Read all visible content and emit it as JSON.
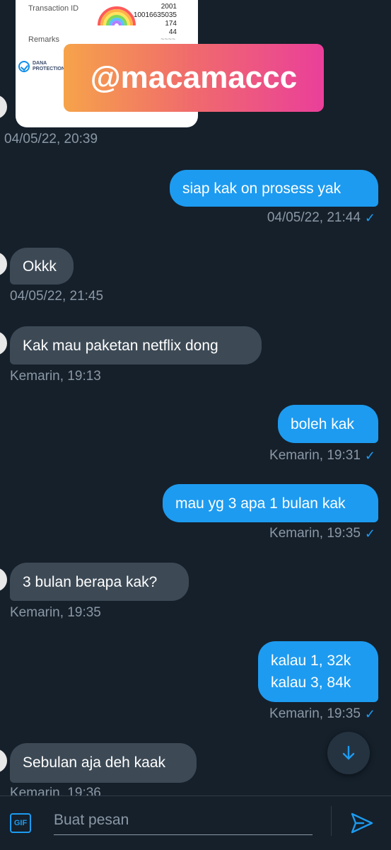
{
  "receipt": {
    "transaction_label": "Transaction ID",
    "transaction_value_line1": "2001",
    "transaction_value_line2": "10016635035",
    "transaction_value_line3": "174",
    "transaction_value_line4": "44",
    "remarks_label": "Remarks",
    "dana_label_line1": "DANA",
    "dana_label_line2": "PROTECTION",
    "timestamp": "04/05/22, 20:39"
  },
  "sticker": {
    "text": "@macamaccc"
  },
  "messages": [
    {
      "dir": "out",
      "text": "siap kak on prosess yak",
      "time": "04/05/22, 21:44"
    },
    {
      "dir": "in",
      "text": "Okkk",
      "time": "04/05/22, 21:45"
    },
    {
      "dir": "in",
      "text": "Kak mau paketan netflix dong",
      "time": "Kemarin, 19:13"
    },
    {
      "dir": "out",
      "text": "boleh kak",
      "time": "Kemarin, 19:31"
    },
    {
      "dir": "out",
      "text": "mau yg 3 apa 1 bulan kak",
      "time": "Kemarin, 19:35"
    },
    {
      "dir": "in",
      "text": "3 bulan berapa kak?",
      "time": "Kemarin, 19:35"
    },
    {
      "dir": "out",
      "text_line1": "kalau 1, 32k",
      "text_line2": "kalau 3, 84k",
      "time": "Kemarin, 19:35"
    },
    {
      "dir": "in",
      "text": "Sebulan aja deh kaak",
      "time": "Kemarin, 19:36"
    }
  ],
  "composer": {
    "gif_label": "GIF",
    "placeholder": "Buat pesan"
  },
  "colors": {
    "background": "#15202b",
    "outgoing": "#1d9bf0",
    "incoming": "#3d4a56",
    "meta": "#8b98a5"
  },
  "icons": {
    "scroll": "arrow-down-icon",
    "send": "send-icon",
    "read": "check-icon"
  }
}
